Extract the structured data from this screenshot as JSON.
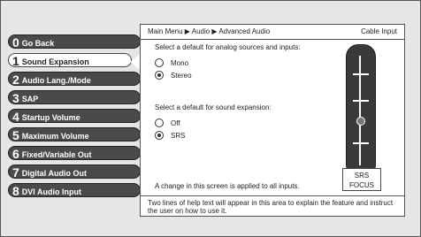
{
  "breadcrumb": "Main Menu ▶ Audio ▶ Advanced Audio",
  "source": "Cable Input",
  "menu": [
    {
      "num": "0",
      "label": "Go Back"
    },
    {
      "num": "1",
      "label": "Sound Expansion"
    },
    {
      "num": "2",
      "label": "Audio Lang./Mode"
    },
    {
      "num": "3",
      "label": "SAP"
    },
    {
      "num": "4",
      "label": "Startup Volume"
    },
    {
      "num": "5",
      "label": "Maximum Volume"
    },
    {
      "num": "6",
      "label": "Fixed/Variable Out"
    },
    {
      "num": "7",
      "label": "Digital Audio Out"
    },
    {
      "num": "8",
      "label": "DVI Audio Input"
    }
  ],
  "section1": {
    "prompt": "Select a default for analog sources and inputs:",
    "options": [
      {
        "label": "Mono",
        "selected": false
      },
      {
        "label": "Stereo",
        "selected": true
      }
    ]
  },
  "section2": {
    "prompt": "Select a default for sound expansion:",
    "options": [
      {
        "label": "Off",
        "selected": false
      },
      {
        "label": "SRS",
        "selected": true
      }
    ]
  },
  "note": "A change in this screen is applied to all inputs.",
  "slider": {
    "line1": "SRS",
    "line2": "FOCUS",
    "level": 0.4
  },
  "help": "Two lines of help text will appear in this area to explain the feature and instruct the user on how to use it."
}
